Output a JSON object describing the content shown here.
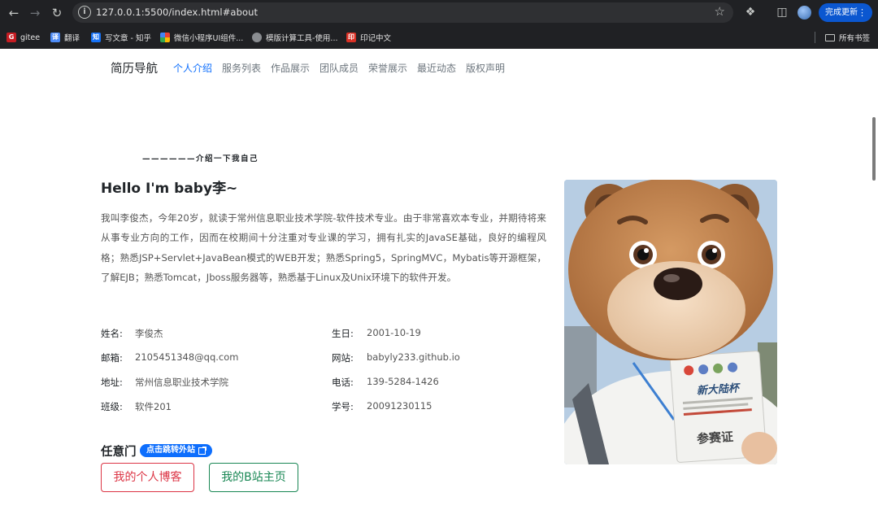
{
  "browser": {
    "url": "127.0.0.1:5500/index.html#about",
    "update_label": "完成更新",
    "bookmarks": [
      {
        "label": "gitee",
        "icon": "gitee-icon",
        "color": "#c71d23",
        "glyph": "G"
      },
      {
        "label": "翻译",
        "icon": "translate-icon",
        "color": "#4e8cf7",
        "glyph": "译"
      },
      {
        "label": "写文章 - 知乎",
        "icon": "zhihu-icon",
        "color": "#1772f6",
        "glyph": "知"
      },
      {
        "label": "微信小程序UI组件...",
        "icon": "grid-icon",
        "color": "#3bb34a",
        "glyph": ""
      },
      {
        "label": "模版计算工具-使用...",
        "icon": "globe-icon",
        "color": "#8a8d91",
        "glyph": ""
      },
      {
        "label": "印记中文",
        "icon": "yinji-icon",
        "color": "#d93025",
        "glyph": "印"
      }
    ],
    "all_bookmarks_label": "所有书签"
  },
  "nav": {
    "brand": "简历导航",
    "links": [
      "个人介绍",
      "服务列表",
      "作品展示",
      "团队成员",
      "荣誉展示",
      "最近动态",
      "版权声明"
    ],
    "active_index": 0
  },
  "about": {
    "subtitle": "——————介绍一下我自己",
    "greeting": "Hello I'm baby李~",
    "bio": "我叫李俊杰，今年20岁，就读于常州信息职业技术学院-软件技术专业。由于非常喜欢本专业，并期待将来从事专业方向的工作，因而在校期间十分注重对专业课的学习，拥有扎实的JavaSE基础，良好的编程风格；熟悉JSP+Servlet+JavaBean模式的WEB开发；熟悉Spring5，SpringMVC，Mybatis等开源框架，了解EJB；熟悉Tomcat，Jboss服务器等，熟悉基于Linux及Unix环境下的软件开发。",
    "info": [
      {
        "label": "姓名:",
        "value": "李俊杰"
      },
      {
        "label": "生日:",
        "value": "2001-10-19"
      },
      {
        "label": "邮箱:",
        "value": "2105451348@qq.com"
      },
      {
        "label": "网站:",
        "value": "babyly233.github.io"
      },
      {
        "label": "地址:",
        "value": "常州信息职业技术学院"
      },
      {
        "label": "电话:",
        "value": "139-5284-1426"
      },
      {
        "label": "班级:",
        "value": "软件201"
      },
      {
        "label": "学号:",
        "value": "20091230115"
      }
    ],
    "portal_title": "任意门",
    "portal_badge": "点击跳转外站",
    "blog_button": "我的个人博客",
    "bilibili_button": "我的B站主页",
    "badge_card_title": "新大陆杯",
    "badge_card_text": "参赛证"
  },
  "colors": {
    "primary": "#0d6efd",
    "danger": "#dc3545",
    "success": "#198754",
    "chrome_bg": "#202124"
  }
}
